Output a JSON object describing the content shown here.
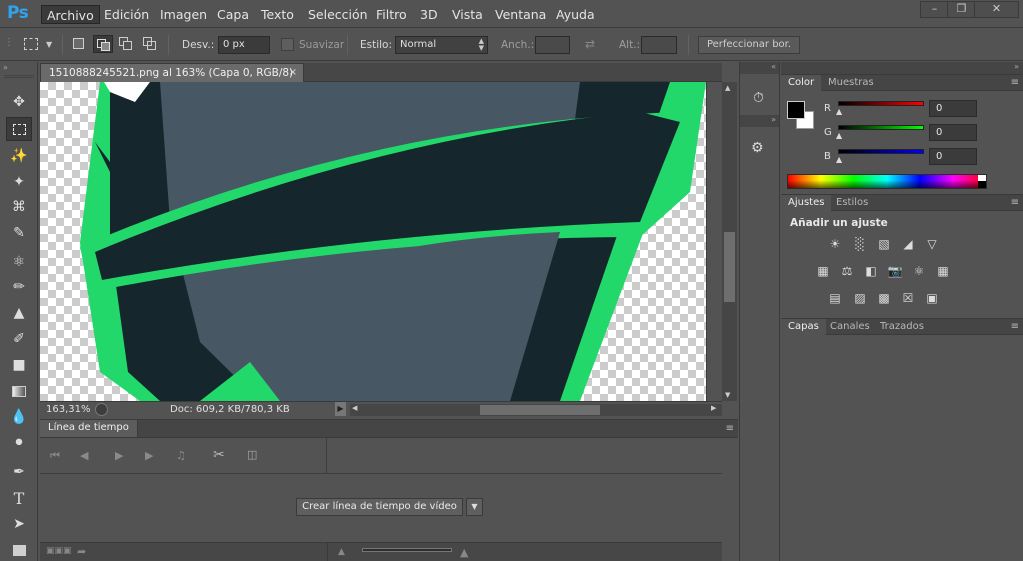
{
  "app": {
    "logo": "Ps"
  },
  "menu": [
    "Archivo",
    "Edición",
    "Imagen",
    "Capa",
    "Texto",
    "Selección",
    "Filtro",
    "3D",
    "Vista",
    "Ventana",
    "Ayuda"
  ],
  "options": {
    "feather_label": "Desv.:",
    "feather_value": "0 px",
    "smooth_label": "Suavizar",
    "style_label": "Estilo:",
    "style_value": "Normal",
    "width_label": "Anch.:",
    "height_label": "Alt.:",
    "refine_button": "Perfeccionar bor."
  },
  "document": {
    "tab_title": "1510888245521.png al 163% (Capa 0, RGB/8)",
    "zoom": "163,31%",
    "doc_info": "Doc: 609,2 KB/780,3 KB"
  },
  "timeline": {
    "tab": "Línea de tiempo",
    "create_button": "Crear línea de tiempo de vídeo"
  },
  "color_panel": {
    "tabs": [
      "Color",
      "Muestras"
    ],
    "r_label": "R",
    "g_label": "G",
    "b_label": "B",
    "r_value": "0",
    "g_value": "0",
    "b_value": "0"
  },
  "adjust_panel": {
    "tabs": [
      "Ajustes",
      "Estilos"
    ],
    "heading": "Añadir un ajuste"
  },
  "layers_panel": {
    "tabs": [
      "Capas",
      "Canales",
      "Trazados"
    ]
  },
  "colors": {
    "accent": "#2fa3ee",
    "artwork_green": "#22d86a",
    "artwork_dark": "#16262d",
    "artwork_gray": "#475763"
  }
}
